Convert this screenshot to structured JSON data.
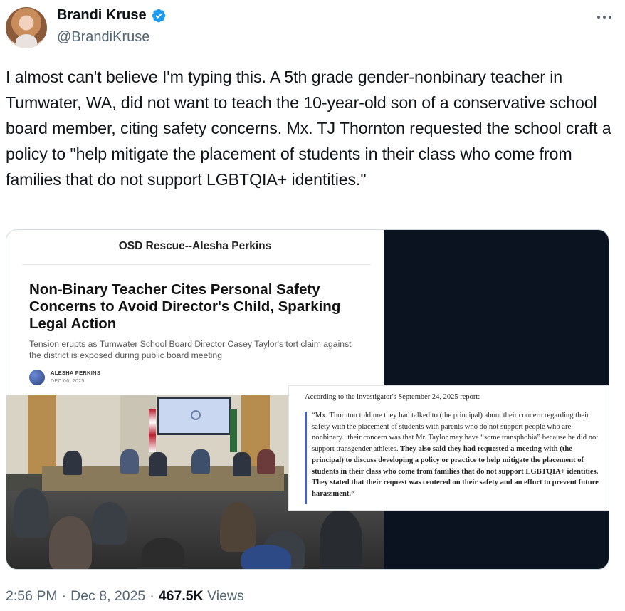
{
  "author": {
    "display_name": "Brandi Kruse",
    "handle": "@BrandiKruse",
    "verified_color": "#1d9bf0"
  },
  "tweet": {
    "text": "I almost can't believe I'm typing this. A 5th grade gender-nonbinary teacher in Tumwater, WA, did not want to teach the 10-year-old son of a conservative school board member, citing safety concerns. Mx. TJ Thornton requested the school craft a policy to \"help mitigate the placement of students in their class who come from families that do not support LGBTQIA+ identities.\""
  },
  "media": {
    "article": {
      "source": "OSD Rescue--Alesha Perkins",
      "headline": "Non-Binary Teacher Cites Personal Safety Concerns to Avoid Director's Child, Sparking Legal Action",
      "subhead": "Tension erupts as Tumwater School Board Director Casey Taylor's tort claim against the district is exposed during public board meeting",
      "author": "ALESHA PERKINS",
      "date": "DEC 06, 2025"
    },
    "quote": {
      "intro": "According to the investigator's September 24, 2025 report:",
      "part1": "“Mx. Thornton told me they had talked to (the principal) about their concern regarding their safety with the placement of students with parents who do not support people who are nonbinary...their concern was that Mr. Taylor may have “some transphobia” because he did not support transgender athletes.",
      "part2": " They also said they had requested a meeting with (the principal) to discuss developing a policy or practice to help mitigate the placement of students in their class who come from families that do not support LGBTQIA+ identities. They stated that their request was centered on their safety and an effort to prevent future harassment.”"
    }
  },
  "meta": {
    "time": "2:56 PM",
    "separator1": "·",
    "date": "Dec 8, 2025",
    "separator2": "·",
    "views_count": "467.5K",
    "views_label": "Views"
  }
}
